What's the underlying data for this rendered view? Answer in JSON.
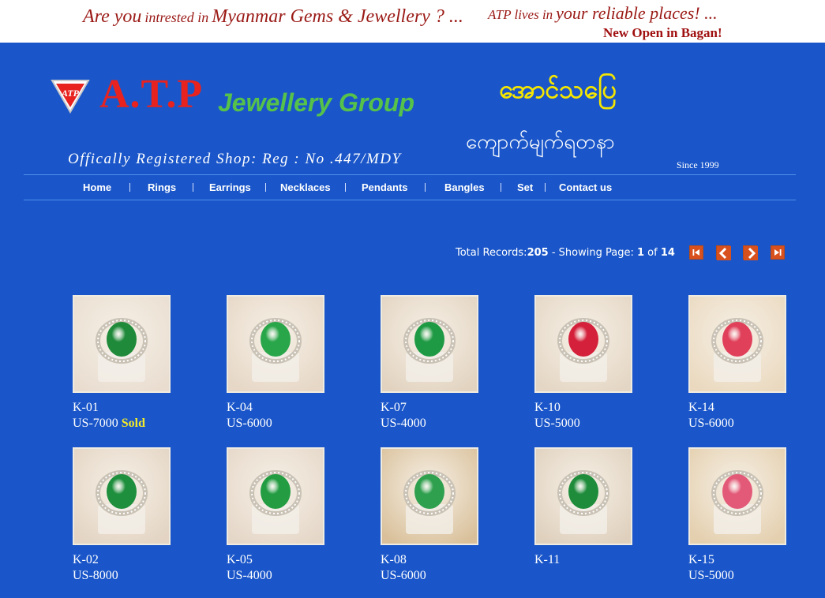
{
  "banner": {
    "line1_a": "Are you",
    "line1_b": "intrested in",
    "line1_c": "Myanmar Gems & Jewellery ? ...",
    "line2_a": "ATP lives in",
    "line2_b": "your reliable places! ...",
    "line3": "New Open in Bagan!"
  },
  "header": {
    "logo_text": "ATP",
    "brand": "A.T.P",
    "brand_sub": "Jewellery Group",
    "myanmar_title": "အောင်သပြေ",
    "myanmar_sub": "ကျောက်မျက်ရတနာ",
    "registration": "Offically Registered Shop: Reg : No .447/MDY",
    "since": "Since 1999"
  },
  "nav": {
    "items": [
      "Home",
      "Rings",
      "Earrings",
      "Necklaces",
      "Pendants",
      "Bangles",
      "Set",
      "Contact us"
    ]
  },
  "pager": {
    "total_label": "Total Records:",
    "total": "205",
    "showing_label": "- Showing Page:",
    "page": "1",
    "of_label": "of",
    "pages": "14"
  },
  "products": [
    {
      "code": "K-01",
      "price": "US-7000",
      "sold": "Sold",
      "stone": "#1f8a3a",
      "base": "#e9ddd0"
    },
    {
      "code": "K-04",
      "price": "US-6000",
      "sold": "",
      "stone": "#2aa64a",
      "base": "#e6d7c6"
    },
    {
      "code": "K-07",
      "price": "US-4000",
      "sold": "",
      "stone": "#1f9a44",
      "base": "#e2d3c0"
    },
    {
      "code": "K-10",
      "price": "US-5000",
      "sold": "",
      "stone": "#d4203a",
      "base": "#e4d6c4"
    },
    {
      "code": "K-14",
      "price": "US-6000",
      "sold": "",
      "stone": "#e0405a",
      "base": "#ead9bf"
    },
    {
      "code": "K-02",
      "price": "US-8000",
      "sold": "",
      "stone": "#1e8f3d",
      "base": "#e3d4c3"
    },
    {
      "code": "K-05",
      "price": "US-4000",
      "sold": "",
      "stone": "#239c42",
      "base": "#e5d7c8"
    },
    {
      "code": "K-08",
      "price": "US-6000",
      "sold": "",
      "stone": "#2fa04e",
      "base": "#d9c09a"
    },
    {
      "code": "K-11",
      "price": "",
      "sold": "",
      "stone": "#1e8c3b",
      "base": "#dfd0bd"
    },
    {
      "code": "K-15",
      "price": "US-5000",
      "sold": "",
      "stone": "#e35a78",
      "base": "#e4cfae"
    }
  ]
}
